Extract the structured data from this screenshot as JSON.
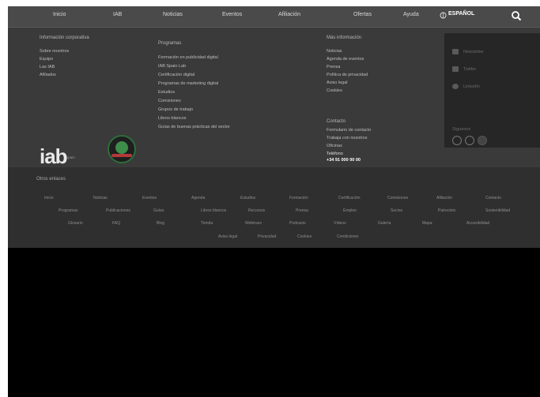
{
  "nav": {
    "items": [
      "Inicio",
      "IAB",
      "Noticias",
      "Eventos",
      "Afiliación",
      "Ofertas",
      "Ayuda"
    ],
    "language": "ESPAÑOL",
    "search_icon": "search-icon",
    "language_icon": "globe-icon"
  },
  "footer": {
    "col1": {
      "title": "Información corporativa",
      "links": [
        "Sobre nosotros",
        "Equipo",
        "Las IAB",
        "Afiliados"
      ]
    },
    "col2": {
      "title": "Programas",
      "links": [
        "Formación en publicidad digital",
        "IAB Spain Lab",
        "Certificación digital",
        "Programas de marketing digital",
        "Estudios",
        "Comisiones",
        "Grupos de trabajo",
        "Libros blancos",
        "Guías de buenas prácticas del sector"
      ]
    },
    "col3": {
      "title": "Más información",
      "links": [
        "Noticias",
        "Agenda de eventos",
        "Prensa",
        "Política de privacidad",
        "Aviso legal",
        "Cookies"
      ],
      "contact_title": "Contacto",
      "contact_links": [
        "Formulario de contacto",
        "Trabaja con nosotros",
        "Oficinas"
      ],
      "phone_label": "Teléfono",
      "phone": "+34 91 000 00 00"
    },
    "social": {
      "items": [
        "Newsletter",
        "Twitter",
        "LinkedIn"
      ],
      "follow_label": "Síguenos"
    },
    "logo": {
      "text": "iab",
      "sub": "spain"
    }
  },
  "strip": {
    "title": "Otros enlaces",
    "row1": [
      "Inicio",
      "Noticias",
      "Eventos",
      "Agenda",
      "Estudios",
      "Formación",
      "Certificación",
      "Comisiones",
      "Afiliación",
      "Contacto"
    ],
    "row2": [
      "Programas",
      "Publicaciones",
      "Guías",
      "Libros blancos",
      "Recursos",
      "Prensa",
      "Empleo",
      "Socios",
      "Patrocinio",
      "Sostenibilidad"
    ],
    "row3": [
      "Glosario",
      "FAQ",
      "Blog",
      "Tienda",
      "Webinars",
      "Podcasts",
      "Vídeos",
      "Galería",
      "Mapa",
      "Accesibilidad"
    ],
    "row4": [
      "Aviso legal",
      "Privacidad",
      "Cookies",
      "Condiciones"
    ]
  }
}
